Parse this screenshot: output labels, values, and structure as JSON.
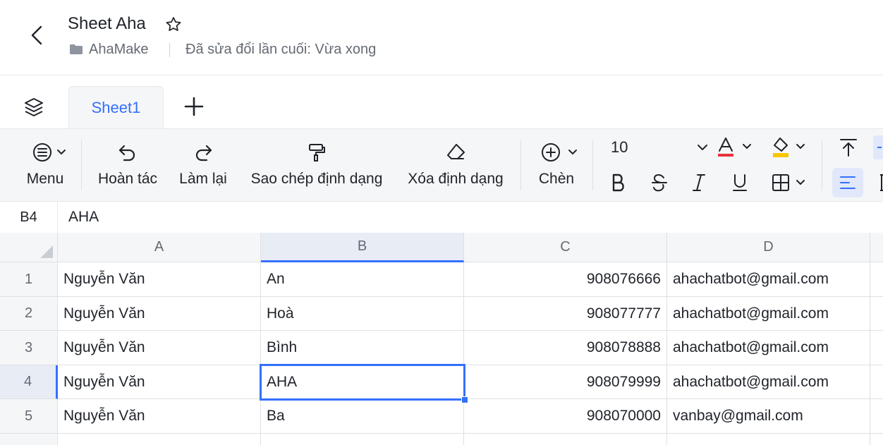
{
  "header": {
    "title": "Sheet Aha",
    "folder": "AhaMake",
    "last_edit": "Đã sửa đổi lần cuối: Vừa xong"
  },
  "tabs": {
    "items": [
      {
        "label": "Sheet1",
        "active": true
      }
    ]
  },
  "toolbar": {
    "menu_label": "Menu",
    "undo_label": "Hoàn tác",
    "redo_label": "Làm lại",
    "format_painter_label": "Sao chép định dạng",
    "clear_format_label": "Xóa định dạng",
    "insert_label": "Chèn",
    "font_size": "10",
    "text_color": "#e8323c",
    "fill_color": "#f7c600",
    "accent": "#3370ff"
  },
  "formula_bar": {
    "cell_ref": "B4",
    "value": "AHA"
  },
  "grid": {
    "columns": [
      "A",
      "B",
      "C",
      "D"
    ],
    "selected_column": "B",
    "selected_row": "4",
    "rows": [
      {
        "num": "1",
        "a": "Nguyễn Văn",
        "b": "An",
        "c": "908076666",
        "d": "ahachatbot@gmail.com"
      },
      {
        "num": "2",
        "a": "Nguyễn Văn",
        "b": "Hoà",
        "c": "908077777",
        "d": "ahachatbot@gmail.com"
      },
      {
        "num": "3",
        "a": "Nguyễn Văn",
        "b": "Bình",
        "c": "908078888",
        "d": "ahachatbot@gmail.com"
      },
      {
        "num": "4",
        "a": "Nguyễn Văn",
        "b": "AHA",
        "c": "908079999",
        "d": "ahachatbot@gmail.com"
      },
      {
        "num": "5",
        "a": "Nguyễn Văn",
        "b": "Ba",
        "c": "908070000",
        "d": "vanbay@gmail.com"
      }
    ]
  }
}
